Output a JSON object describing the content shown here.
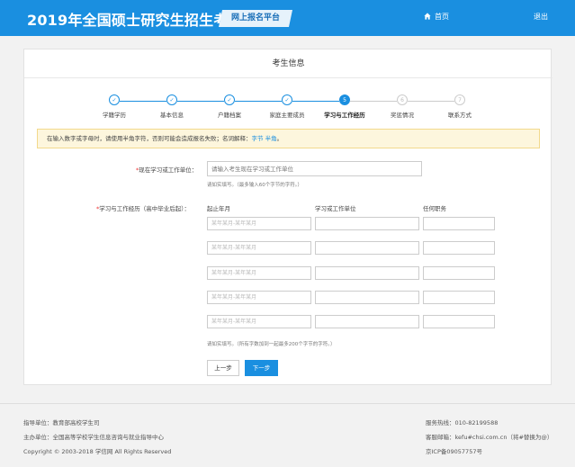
{
  "header": {
    "title": "2019年全国硕士研究生招生考试",
    "badge": "网上报名平台",
    "home": "首页",
    "logout": "退出"
  },
  "panel": {
    "title": "考生信息"
  },
  "steps": [
    {
      "num": "✓",
      "label": "学籍学历",
      "state": "done"
    },
    {
      "num": "✓",
      "label": "基本信息",
      "state": "done"
    },
    {
      "num": "✓",
      "label": "户籍档案",
      "state": "done"
    },
    {
      "num": "✓",
      "label": "家庭主要成员",
      "state": "done"
    },
    {
      "num": "5",
      "label": "学习与工作经历",
      "state": "current"
    },
    {
      "num": "6",
      "label": "奖惩情况",
      "state": "todo"
    },
    {
      "num": "7",
      "label": "联系方式",
      "state": "todo"
    }
  ],
  "notice": {
    "text": "在输入数字或字母时，请使用半角字符，否则可能会造成报名失败；名词解释：",
    "link": "字节 半角",
    "suffix": "。"
  },
  "form": {
    "unit_label": "现在学习或工作单位：",
    "unit_placeholder": "请输入考生现在学习或工作单位",
    "unit_hint": "请如实填写。（最多输入60个字节的字符。）",
    "history_label": "学习与工作经历（高中毕业后起）：",
    "col_period": "起止年月",
    "col_unit": "学习或工作单位",
    "col_position": "任何职务",
    "period_placeholder": "某年某月-某年某月",
    "rows": [
      1,
      2,
      3,
      4,
      5
    ],
    "history_hint": "请如实填写。（所有字数加到一起最多200个字节的字符。）"
  },
  "buttons": {
    "prev": "上一步",
    "next": "下一步"
  },
  "footer": {
    "guide": "指导单位：教育部高校学生司",
    "host": "主办单位：全国高等学校学生信息咨询与就业指导中心",
    "copyright": "Copyright © 2003-2018 学信网 All Rights Reserved",
    "hotline": "服务热线：010-82199588",
    "email": "客服邮箱：kefu#chsi.com.cn（将#替换为@）",
    "icp": "京ICP备09057757号"
  },
  "colors": {
    "primary": "#1a8fe0",
    "notice_bg": "#fdf6dd",
    "required": "#ee3333"
  }
}
